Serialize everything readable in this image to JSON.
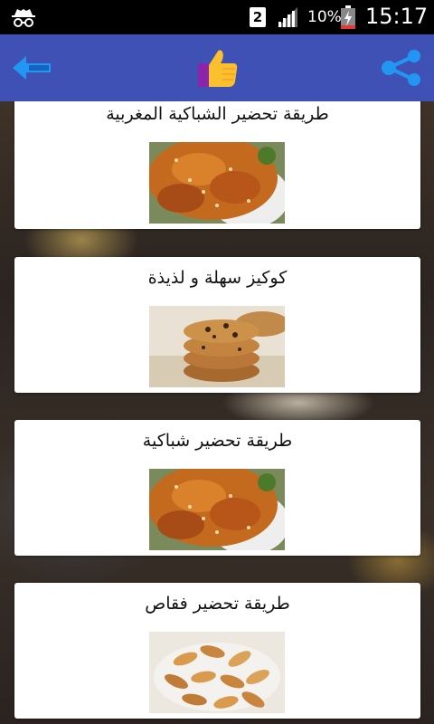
{
  "status_bar": {
    "incognito_icon": "spy-icon",
    "sim_label": "2",
    "battery_percent": "10%",
    "time": "15:17"
  },
  "toolbar": {
    "background": "#3f51b5",
    "back_icon": "arrow-left-icon",
    "like_icon": "thumbs-up-icon",
    "share_icon": "share-icon"
  },
  "recipes": [
    {
      "title": "طريقة تحضير الشباكية المغربية",
      "image": "chebakia"
    },
    {
      "title": "كوكيز سهلة و لذيذة",
      "image": "cookies"
    },
    {
      "title": "طريقة تحضير شباكية",
      "image": "chebakia"
    },
    {
      "title": "طريقة تحضير فقاص",
      "image": "fekkas"
    }
  ]
}
